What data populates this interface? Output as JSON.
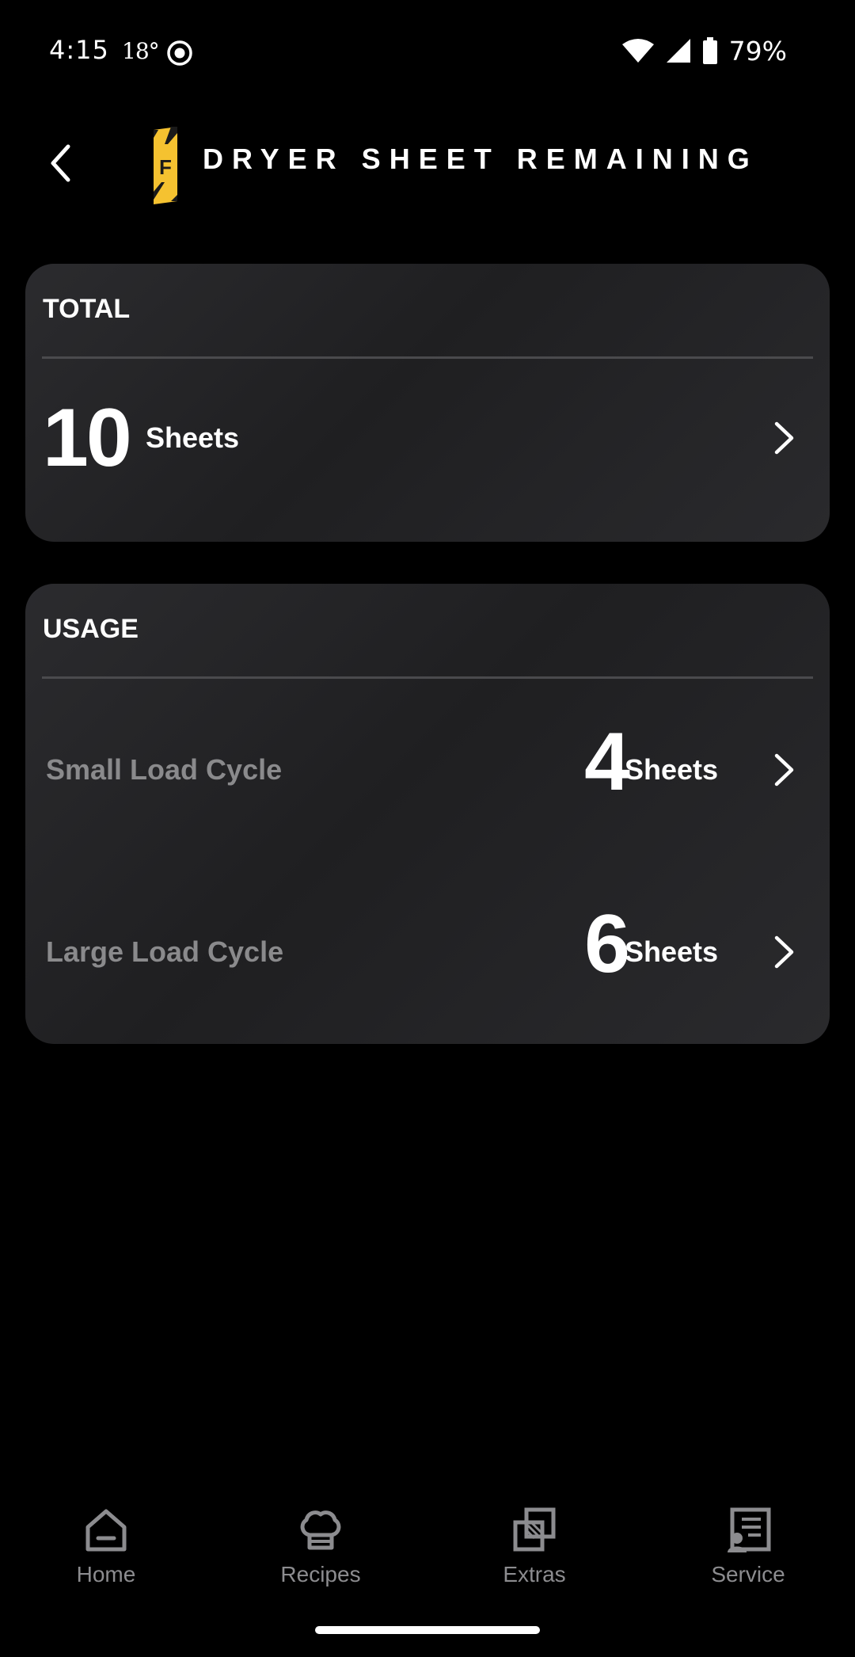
{
  "status_bar": {
    "time": "4:15",
    "temperature": "18°",
    "battery": "79%",
    "icons": [
      "record-icon",
      "wifi-icon",
      "cellular-signal-icon",
      "battery-icon"
    ]
  },
  "header": {
    "title": "DRYER SHEET REMAINING",
    "logo_letter": "F",
    "back_icon": "chevron-left-icon",
    "logo_color": "#f5c230"
  },
  "total_card": {
    "heading": "TOTAL",
    "value": "10",
    "unit": "Sheets"
  },
  "usage_card": {
    "heading": "USAGE",
    "rows": [
      {
        "label": "Small Load Cycle",
        "value": "4",
        "unit": "Sheets"
      },
      {
        "label": "Large Load Cycle",
        "value": "6",
        "unit": "Sheets"
      }
    ]
  },
  "bottom_nav": {
    "items": [
      {
        "label": "Home",
        "icon": "home-icon"
      },
      {
        "label": "Recipes",
        "icon": "chef-hat-icon"
      },
      {
        "label": "Extras",
        "icon": "extras-icon"
      },
      {
        "label": "Service",
        "icon": "service-icon"
      }
    ]
  },
  "colors": {
    "background": "#000000",
    "card": "#252527",
    "muted_text": "#8a8a8c",
    "accent": "#f5c230"
  }
}
